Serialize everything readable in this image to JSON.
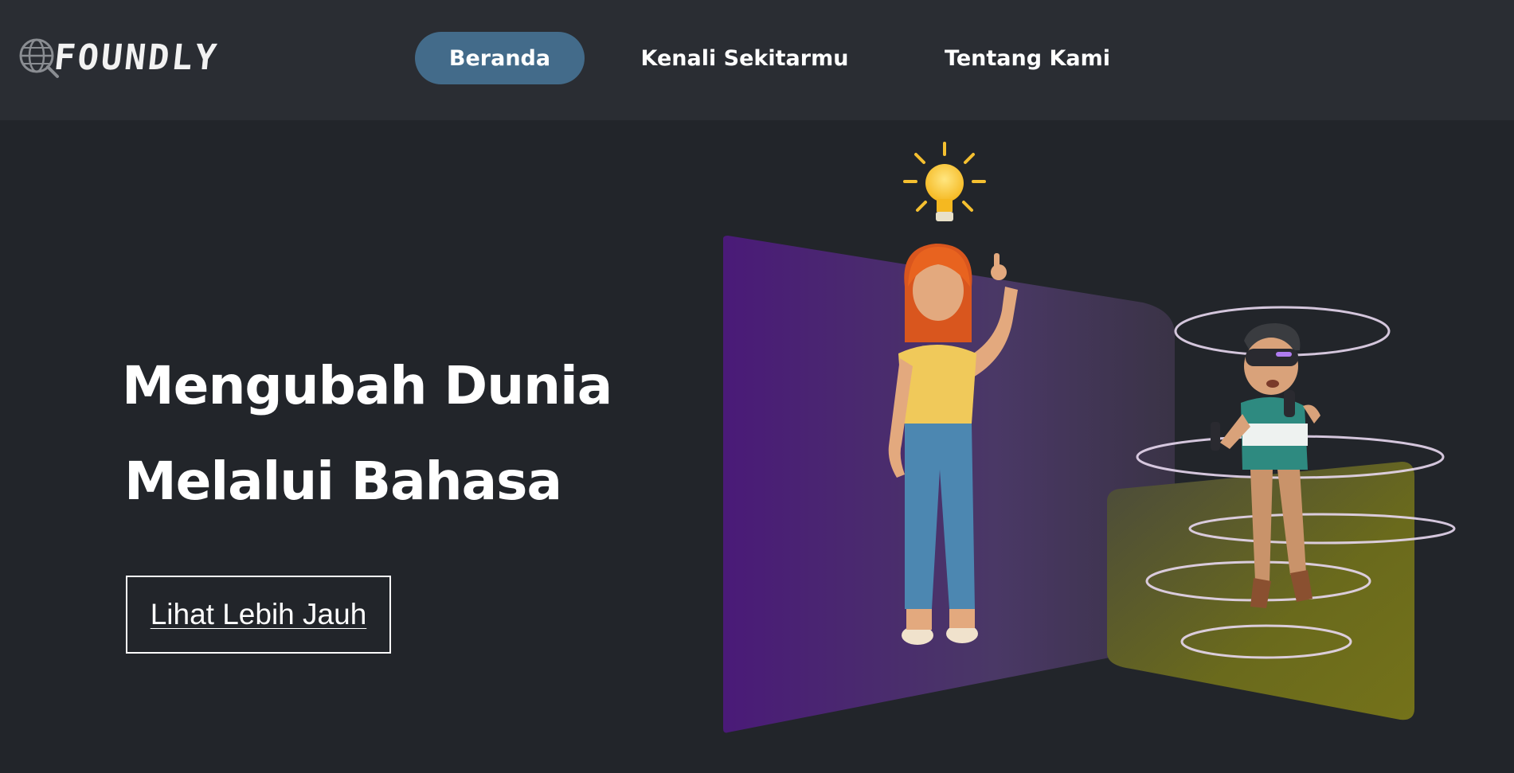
{
  "brand": {
    "logo_text": "FOUNDLY",
    "logo_icon": "globe-magnifier-icon"
  },
  "nav": {
    "items": [
      {
        "label": "Beranda",
        "active": true
      },
      {
        "label": "Kenali Sekitarmu",
        "active": false
      },
      {
        "label": "Tentang Kami",
        "active": false
      }
    ]
  },
  "hero": {
    "title_line1": "Mengubah Dunia",
    "title_line2": "Melalui Bahasa",
    "cta_label": "Lihat Lebih Jauh"
  },
  "colors": {
    "navbar_bg": "#2a2d33",
    "page_bg": "#22252a",
    "active_nav_bg": "#436b8a",
    "text": "#ffffff"
  }
}
